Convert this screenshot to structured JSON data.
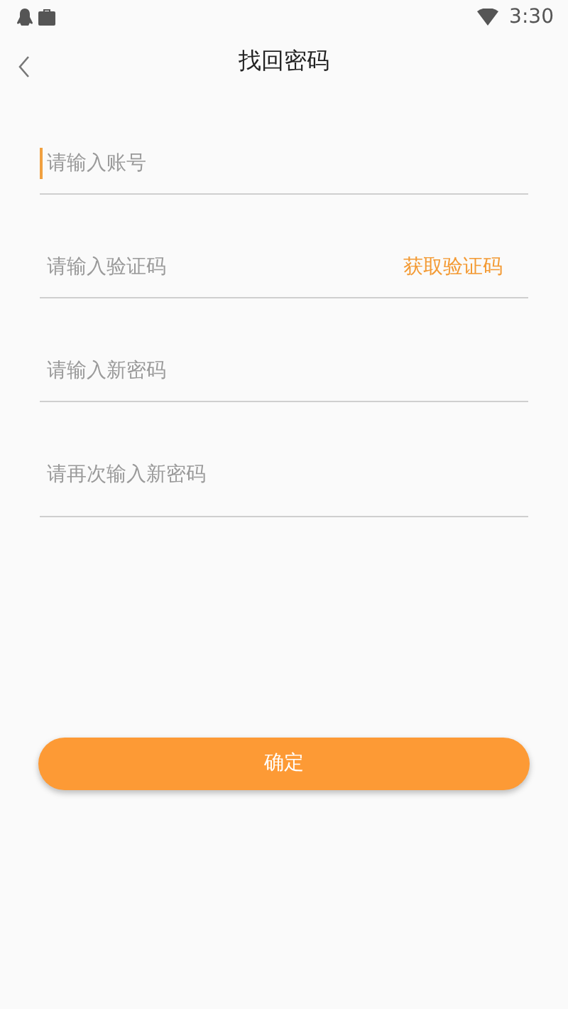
{
  "status_bar": {
    "time": "3:30"
  },
  "header": {
    "title": "找回密码"
  },
  "fields": [
    {
      "placeholder": "请输入账号",
      "focused": true
    },
    {
      "placeholder": "请输入验证码",
      "focused": false,
      "action": "获取验证码"
    },
    {
      "placeholder": "请输入新密码",
      "focused": false
    },
    {
      "placeholder": "请再次输入新密码",
      "focused": false
    }
  ],
  "submit": "确定"
}
